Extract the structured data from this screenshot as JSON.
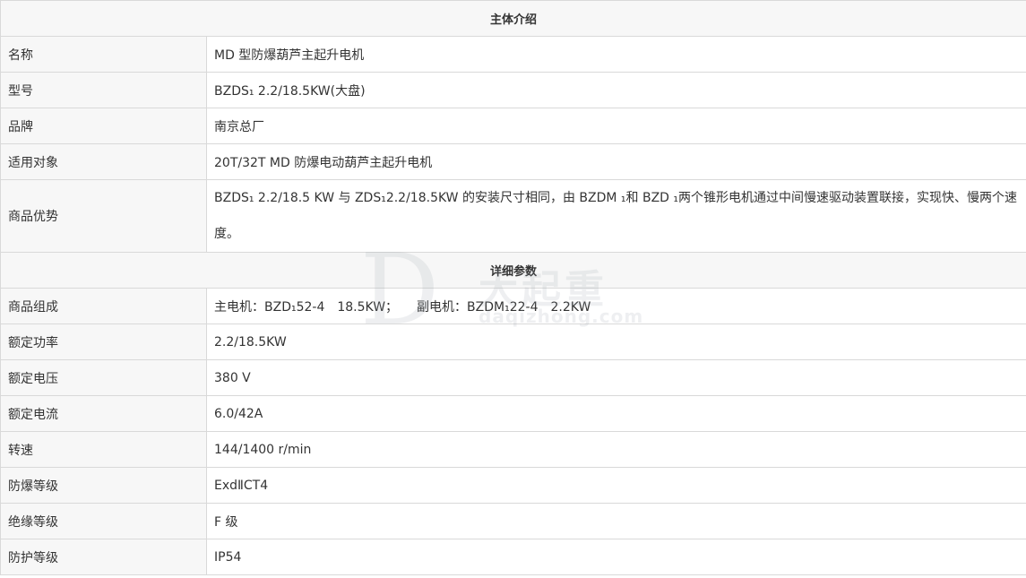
{
  "intro": {
    "title": "主体介绍",
    "rows": [
      {
        "label": "名称",
        "value": "MD 型防爆葫芦主起升电机"
      },
      {
        "label": "型号",
        "value": "BZDS₁ 2.2/18.5KW(大盘)"
      },
      {
        "label": "品牌",
        "value": "南京总厂"
      },
      {
        "label": "适用对象",
        "value": "20T/32T MD 防爆电动葫芦主起升电机"
      },
      {
        "label": "商品优势",
        "value": "BZDS₁ 2.2/18.5 KW 与 ZDS₁2.2/18.5KW 的安装尺寸相同，由 BZDM ₁和 BZD ₁两个锥形电机通过中间慢速驱动装置联接，实现快、慢两个速度。"
      }
    ]
  },
  "details": {
    "title": "详细参数",
    "rows": [
      {
        "label": "商品组成",
        "value": "主电机：BZD₁52-4　18.5KW；　　副电机：BZDM₁22-4　2.2KW"
      },
      {
        "label": "额定功率",
        "value": "2.2/18.5KW"
      },
      {
        "label": "额定电压",
        "value": "380 V"
      },
      {
        "label": "额定电流",
        "value": "6.0/42A"
      },
      {
        "label": "转速",
        "value": "144/1400 r/min"
      },
      {
        "label": "防爆等级",
        "value": "ExdⅡCT4"
      },
      {
        "label": "绝缘等级",
        "value": "F 级"
      },
      {
        "label": "防护等级",
        "value": "IP54"
      }
    ]
  },
  "watermark": {
    "logo_letter": "D",
    "cn": "大起重",
    "en": "daqizhong.com"
  }
}
